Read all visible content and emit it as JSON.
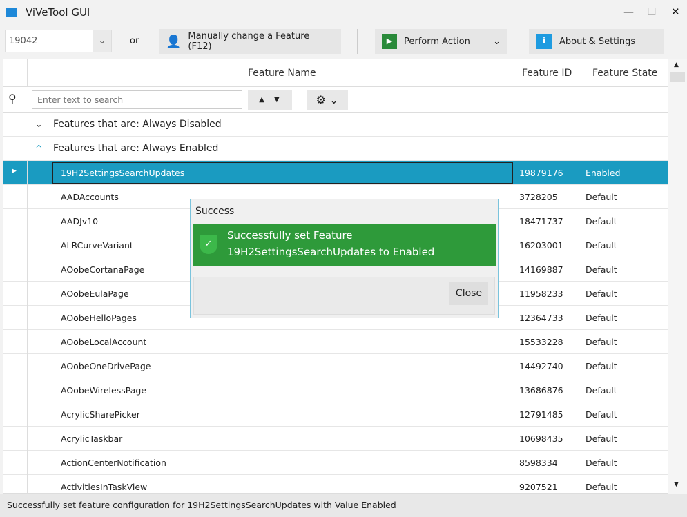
{
  "window": {
    "title": "ViVeTool GUI",
    "minimize": "—",
    "maximize": "☐",
    "close": "✕"
  },
  "toolbar": {
    "build": "19042",
    "or": "or",
    "manual": "Manually change a Feature (F12)",
    "perform": "Perform Action",
    "about": "About & Settings"
  },
  "table": {
    "columns": [
      "Feature Name",
      "Feature ID",
      "Feature State"
    ],
    "search_placeholder": "Enter text to search",
    "groups": [
      {
        "label": "Features that are: Always Disabled",
        "expanded": false
      },
      {
        "label": "Features that are: Always Enabled",
        "expanded": true
      }
    ],
    "rows": [
      {
        "name": "19H2SettingsSearchUpdates",
        "id": "19879176",
        "state": "Enabled"
      },
      {
        "name": "AADAccounts",
        "id": "3728205",
        "state": "Default"
      },
      {
        "name": "AADJv10",
        "id": "18471737",
        "state": "Default"
      },
      {
        "name": "ALRCurveVariant",
        "id": "16203001",
        "state": "Default"
      },
      {
        "name": "AOobeCortanaPage",
        "id": "14169887",
        "state": "Default"
      },
      {
        "name": "AOobeEulaPage",
        "id": "11958233",
        "state": "Default"
      },
      {
        "name": "AOobeHelloPages",
        "id": "12364733",
        "state": "Default"
      },
      {
        "name": "AOobeLocalAccount",
        "id": "15533228",
        "state": "Default"
      },
      {
        "name": "AOobeOneDrivePage",
        "id": "14492740",
        "state": "Default"
      },
      {
        "name": "AOobeWirelessPage",
        "id": "13686876",
        "state": "Default"
      },
      {
        "name": "AcrylicSharePicker",
        "id": "12791485",
        "state": "Default"
      },
      {
        "name": "AcrylicTaskbar",
        "id": "10698435",
        "state": "Default"
      },
      {
        "name": "ActionCenterNotification",
        "id": "8598334",
        "state": "Default"
      },
      {
        "name": "ActivitiesInTaskView",
        "id": "9207521",
        "state": "Default"
      }
    ]
  },
  "dialog": {
    "title": "Success",
    "line1": "Successfully set Feature",
    "line2": "19H2SettingsSearchUpdates to Enabled",
    "close": "Close",
    "color": "#2e9a3a"
  },
  "status": "Successfully set feature configuration for  19H2SettingsSearchUpdates with Value Enabled"
}
